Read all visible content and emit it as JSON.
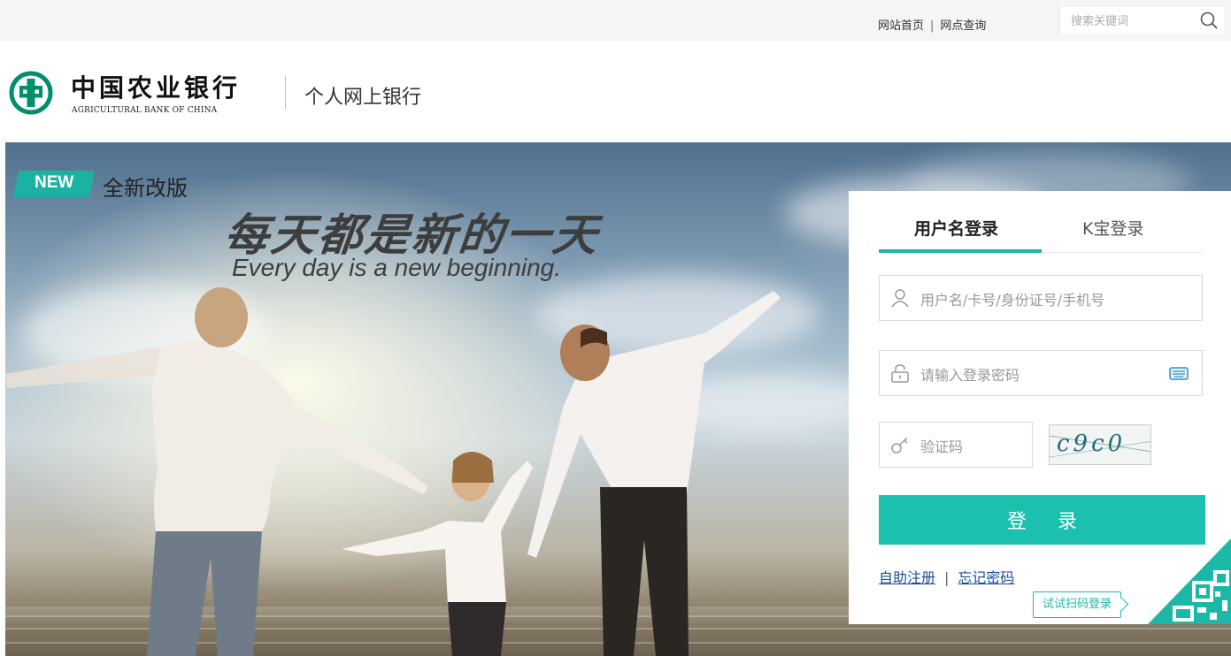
{
  "topbar": {
    "link_home": "网站首页",
    "separator": "|",
    "link_branch": "网点查询",
    "search_placeholder": "搜索关键词",
    "search_icon": "search-icon"
  },
  "brand": {
    "name_cn": "中国农业银行",
    "name_en": "AGRICULTURAL BANK OF CHINA",
    "product": "个人网上银行",
    "logo_icon": "abc-coin-logo-icon",
    "color": "#008f6b"
  },
  "hero": {
    "badge": "NEW",
    "badge_text": "全新改版",
    "slogan_cn": "每天都是新的一天",
    "slogan_en": "Every day is a new beginning.",
    "badge_color": "#1cb2a3"
  },
  "login": {
    "tab_username": "用户名登录",
    "tab_kbao": "K宝登录",
    "username_placeholder": "用户名/卡号/身份证号/手机号",
    "password_placeholder": "请输入登录密码",
    "captcha_placeholder": "验证码",
    "captcha_text": "c9c0",
    "login_button": "登 录",
    "link_register": "自助注册",
    "link_sep": "|",
    "link_forgot": "忘记密码",
    "qr_tip": "试试扫码登录",
    "accent_color": "#1cc0ae",
    "icons": [
      "user-icon",
      "lock-icon",
      "keyboard-icon",
      "key-icon",
      "qr-code-icon"
    ]
  }
}
